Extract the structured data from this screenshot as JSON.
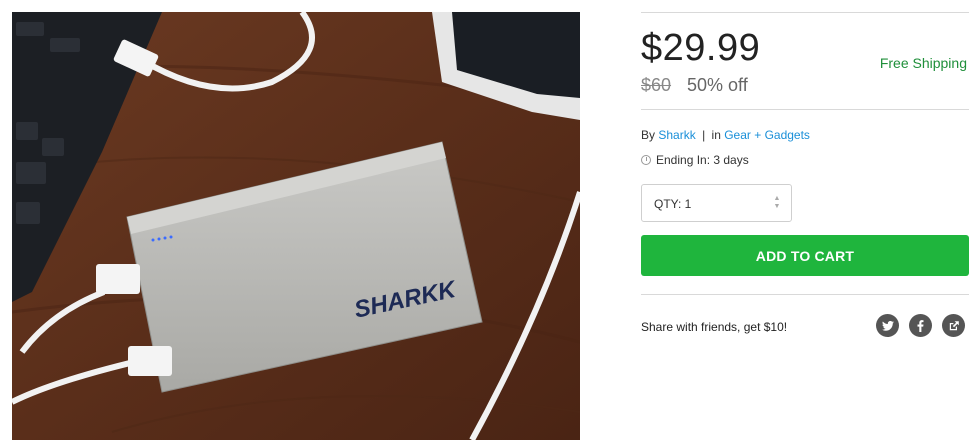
{
  "product_image": {
    "brand_logo": "SHARKK"
  },
  "pricing": {
    "price": "$29.99",
    "original_price": "$60",
    "discount": "50% off",
    "shipping": "Free Shipping"
  },
  "meta": {
    "by_prefix": "By",
    "seller": "Sharkk",
    "in_prefix": "in",
    "category": "Gear + Gadgets",
    "ending": "Ending In: 3 days"
  },
  "quantity": {
    "label": "QTY: 1"
  },
  "cart": {
    "label": "ADD TO CART",
    "color": "#1fb53d"
  },
  "share": {
    "text": "Share with friends, get $10!",
    "icons": [
      "twitter-icon",
      "facebook-icon",
      "share-icon"
    ]
  }
}
